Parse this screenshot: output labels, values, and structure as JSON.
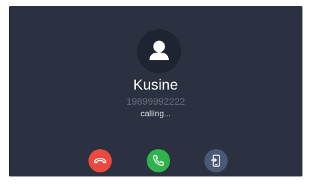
{
  "call": {
    "contact_name": "Kusine",
    "phone_number": "19899992222",
    "status": "calling..."
  },
  "avatar": {
    "icon": "person-icon"
  },
  "actions": [
    {
      "name": "hangup",
      "icon": "phone-hangup-icon",
      "color": "#e9493f"
    },
    {
      "name": "answer",
      "icon": "phone-answer-icon",
      "color": "#2fb34c"
    },
    {
      "name": "transfer",
      "icon": "transfer-to-device-icon",
      "color": "#4b5876"
    }
  ],
  "colors": {
    "background": "#2b3140",
    "avatar_bg": "#1e2431",
    "number_text": "#66707f"
  }
}
